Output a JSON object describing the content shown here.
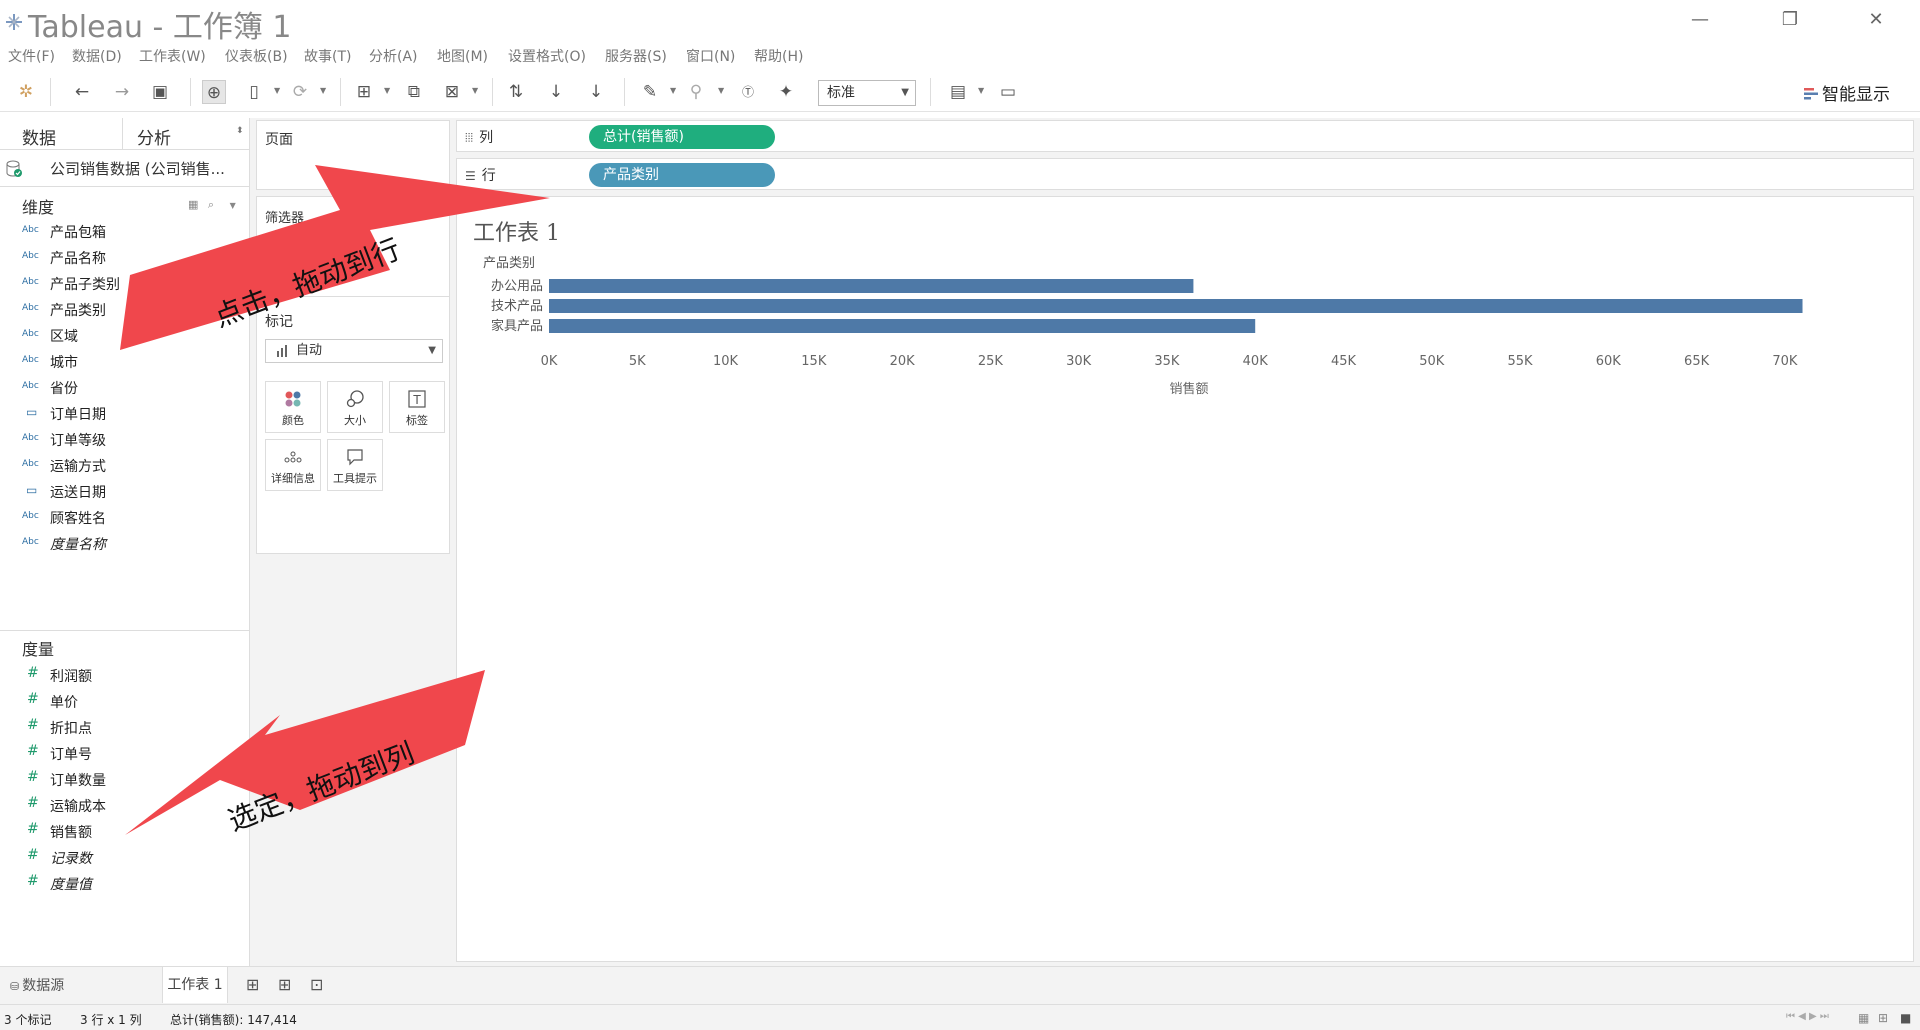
{
  "window": {
    "title": "Tableau - 工作簿 1",
    "minimize": "—",
    "maximize": "❐",
    "close": "✕"
  },
  "menu": [
    "文件(F)",
    "数据(D)",
    "工作表(W)",
    "仪表板(B)",
    "故事(T)",
    "分析(A)",
    "地图(M)",
    "设置格式(O)",
    "服务器(S)",
    "窗口(N)",
    "帮助(H)"
  ],
  "toolbar": {
    "fit_select": "标准",
    "show_me": "智能显示"
  },
  "left_pane": {
    "tab_data": "数据",
    "tab_analysis": "分析",
    "datasource": "公司销售数据 (公司销售...",
    "dimensions_title": "维度",
    "dimensions": [
      {
        "type": "Abc",
        "name": "产品包箱"
      },
      {
        "type": "Abc",
        "name": "产品名称"
      },
      {
        "type": "Abc",
        "name": "产品子类别"
      },
      {
        "type": "Abc",
        "name": "产品类别"
      },
      {
        "type": "Abc",
        "name": "区域"
      },
      {
        "type": "Abc",
        "name": "城市"
      },
      {
        "type": "Abc",
        "name": "省份"
      },
      {
        "type": "date",
        "name": "订单日期"
      },
      {
        "type": "Abc",
        "name": "订单等级"
      },
      {
        "type": "Abc",
        "name": "运输方式"
      },
      {
        "type": "date",
        "name": "运送日期"
      },
      {
        "type": "Abc",
        "name": "顾客姓名"
      },
      {
        "type": "Abc",
        "name": "度量名称",
        "italic": true
      }
    ],
    "measures_title": "度量",
    "measures": [
      {
        "name": "利润额"
      },
      {
        "name": "单价"
      },
      {
        "name": "折扣点"
      },
      {
        "name": "订单号"
      },
      {
        "name": "订单数量"
      },
      {
        "name": "运输成本"
      },
      {
        "name": "销售额"
      },
      {
        "name": "记录数",
        "italic": true
      },
      {
        "name": "度量值",
        "italic": true
      }
    ]
  },
  "cards": {
    "pages": "页面",
    "filters": "筛选器",
    "marks": "标记",
    "marks_type": "自动",
    "mark_buttons": [
      "颜色",
      "大小",
      "标签",
      "详细信息",
      "工具提示"
    ]
  },
  "shelves": {
    "columns_label": "列",
    "columns_pill": "总计(销售额)",
    "rows_label": "行",
    "rows_pill": "产品类别",
    "columns_pill_color": "#1fae7e",
    "rows_pill_color": "#4a98b8"
  },
  "view": {
    "sheet_title": "工作表 1"
  },
  "chart_data": {
    "type": "bar",
    "orientation": "horizontal",
    "row_header": "产品类别",
    "categories": [
      "办公用品",
      "技术产品",
      "家具产品"
    ],
    "values": [
      36500,
      71000,
      40000
    ],
    "xlabel": "销售额",
    "xlim": [
      0,
      72500
    ],
    "xticks": [
      0,
      5000,
      10000,
      15000,
      20000,
      25000,
      30000,
      35000,
      40000,
      45000,
      50000,
      55000,
      60000,
      65000,
      70000
    ],
    "xtick_labels": [
      "0K",
      "5K",
      "10K",
      "15K",
      "20K",
      "25K",
      "30K",
      "35K",
      "40K",
      "45K",
      "50K",
      "55K",
      "60K",
      "65K",
      "70K"
    ],
    "bar_color": "#4e79a7"
  },
  "annotations": {
    "arrow1_text": "点击，拖动到行",
    "arrow2_text": "选定，拖动到列",
    "arrow_color": "#f0474c"
  },
  "bottom_tabs": {
    "datasource": "数据源",
    "sheet": "工作表 1"
  },
  "status": {
    "marks": "3 个标记",
    "dims": "3 行 x 1 列",
    "sum": "总计(销售额): 147,414"
  }
}
